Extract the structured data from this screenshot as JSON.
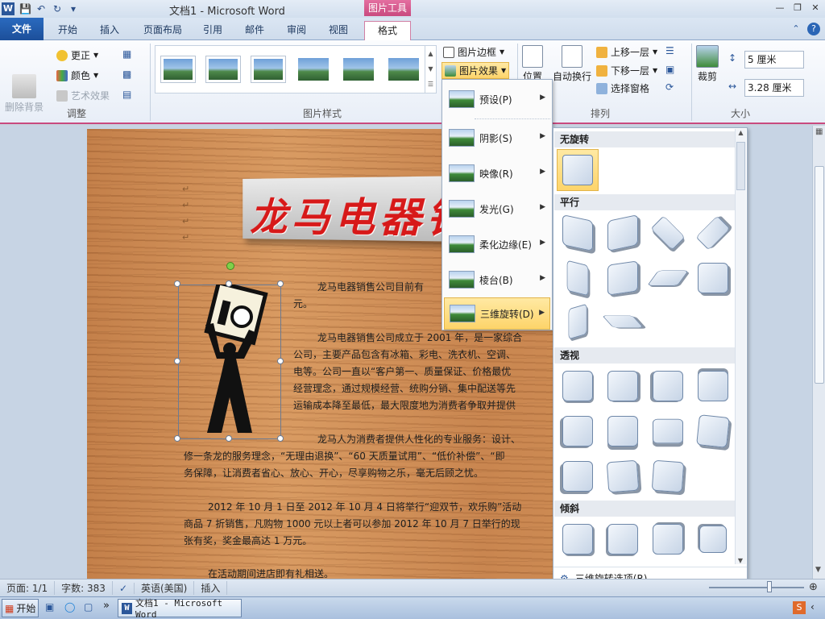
{
  "window": {
    "title": "文档1 - Microsoft Word",
    "context_tab_label": "图片工具",
    "app_icon": "W"
  },
  "tabs": [
    "文件",
    "开始",
    "插入",
    "页面布局",
    "引用",
    "邮件",
    "审阅",
    "视图",
    "格式"
  ],
  "ribbon": {
    "adjust": {
      "remove_bg": "删除背景",
      "correct": "更正",
      "color": "颜色",
      "art_effect": "艺术效果",
      "group_label": "调整"
    },
    "picture_styles": {
      "group_label": "图片样式"
    },
    "picture_border": "图片边框",
    "picture_effects": "图片效果",
    "arrange": {
      "position": "位置",
      "wrap": "自动换行",
      "bring_forward": "上移一层",
      "send_backward": "下移一层",
      "selection_pane": "选择窗格",
      "group_label": "排列"
    },
    "size": {
      "crop": "裁剪",
      "height": "5 厘米",
      "width": "3.28 厘米",
      "group_label": "大小"
    }
  },
  "effects_menu": [
    {
      "label": "预设(P)"
    },
    {
      "label": "阴影(S)"
    },
    {
      "label": "映像(R)"
    },
    {
      "label": "发光(G)"
    },
    {
      "label": "柔化边缘(E)"
    },
    {
      "label": "棱台(B)"
    },
    {
      "label": "三维旋转(D)",
      "highlighted": true
    }
  ],
  "rotation_panel": {
    "sections": [
      {
        "title": "无旋转",
        "count": 1
      },
      {
        "title": "平行",
        "count": 10
      },
      {
        "title": "透视",
        "count": 11
      },
      {
        "title": "倾斜",
        "count": 4
      }
    ],
    "footer": "三维旋转选项(R)..."
  },
  "document": {
    "banner_text": "龙马电器销",
    "paragraphs": [
      "龙马电器销售公司目前有",
      "元。",
      "龙马电器销售公司成立于 2001 年，是一家综合",
      "公司，主要产品包含有冰箱、彩电、洗衣机、空调、",
      "电等。公司一直以“客户第一、质量保证、价格最优",
      "经营理念，通过规模经营、统购分销、集中配送等先",
      "运输成本降至最低，最大限度地为消费者争取并提供",
      "龙马人为消费者提供人性化的专业服务：设计、",
      "修一条龙的服务理念，“无理由退换”、“60 天质量试用”、“低价补偿”、“即",
      "务保障，让消费者省心、放心、开心，尽享购物之乐，毫无后顾之忧。",
      "2012 年 10 月 1 日至 2012 年 10 月 4 日将举行“迎双节，欢乐购”活动",
      "商品 7 折销售，凡购物 1000 元以上者可以参加 2012 年 10 月 7 日举行的现",
      "张有奖，奖金最高达 1 万元。",
      "在活动期间进店即有礼相送。"
    ]
  },
  "statusbar": {
    "page": "页面: 1/1",
    "words": "字数: 383",
    "language": "英语(美国)",
    "mode": "插入"
  },
  "taskbar": {
    "start": "开始",
    "word_task": "文档1 - Microsoft Word"
  }
}
